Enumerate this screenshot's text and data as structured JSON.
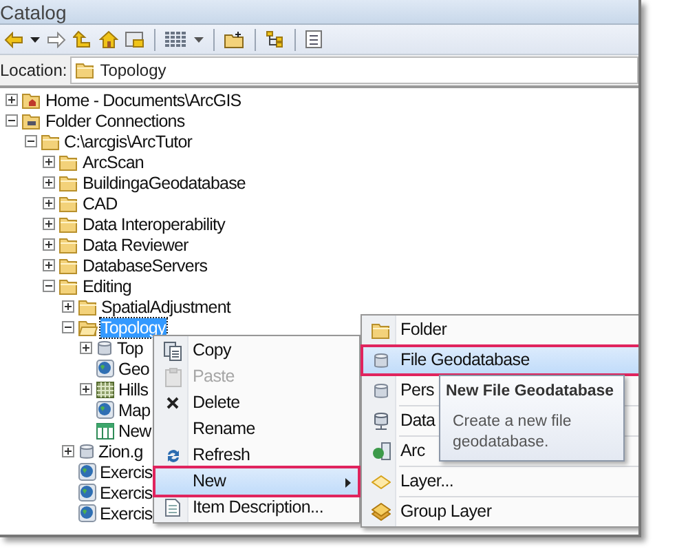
{
  "window": {
    "title": "Catalog"
  },
  "location": {
    "label": "Location:",
    "value": "Topology"
  },
  "tree": [
    {
      "label": "Home - Documents\\ArcGIS",
      "kind": "home",
      "expanded": false,
      "selected": false
    },
    {
      "label": "Folder Connections",
      "kind": "connections",
      "expanded": true,
      "selected": false,
      "children": [
        {
          "label": "C:\\arcgis\\ArcTutor",
          "kind": "folder",
          "expanded": true,
          "selected": false,
          "children": [
            {
              "label": "ArcScan",
              "kind": "folder",
              "expanded": false,
              "selected": false
            },
            {
              "label": "BuildingaGeodatabase",
              "kind": "folder",
              "expanded": false,
              "selected": false
            },
            {
              "label": "CAD",
              "kind": "folder",
              "expanded": false,
              "selected": false
            },
            {
              "label": "Data Interoperability",
              "kind": "folder",
              "expanded": false,
              "selected": false
            },
            {
              "label": "Data Reviewer",
              "kind": "folder",
              "expanded": false,
              "selected": false
            },
            {
              "label": "DatabaseServers",
              "kind": "folder",
              "expanded": false,
              "selected": false
            },
            {
              "label": "Editing",
              "kind": "folder",
              "expanded": true,
              "selected": false,
              "children": [
                {
                  "label": "SpatialAdjustment",
                  "kind": "folder",
                  "expanded": false,
                  "selected": false
                },
                {
                  "label": "Topology",
                  "kind": "openfolder",
                  "expanded": true,
                  "selected": true,
                  "children": [
                    {
                      "label": "Top",
                      "kind": "gdb",
                      "expanded": false,
                      "selected": false
                    },
                    {
                      "label": "Geo",
                      "kind": "globe",
                      "selected": false
                    },
                    {
                      "label": "Hills",
                      "kind": "raster",
                      "expanded": false,
                      "selected": false
                    },
                    {
                      "label": "Map",
                      "kind": "globe",
                      "selected": false
                    },
                    {
                      "label": "New",
                      "kind": "table",
                      "selected": false
                    }
                  ]
                },
                {
                  "label": "Zion.g",
                  "kind": "gdb",
                  "expanded": false,
                  "selected": false
                },
                {
                  "label": "Exercis",
                  "kind": "globe",
                  "selected": false
                },
                {
                  "label": "Exercis",
                  "kind": "globe",
                  "selected": false
                },
                {
                  "label": "Exercis",
                  "kind": "globe",
                  "selected": false
                }
              ]
            }
          ]
        }
      ]
    }
  ],
  "context_menu": {
    "items": [
      {
        "label": "Copy",
        "kind": "copy",
        "disabled": false,
        "selected": false
      },
      {
        "label": "Paste",
        "kind": "paste",
        "disabled": true,
        "selected": false
      },
      {
        "label": "Delete",
        "kind": "delete",
        "disabled": false,
        "selected": false
      },
      {
        "label": "Rename",
        "kind": "plain",
        "disabled": false,
        "selected": false
      },
      {
        "label": "Refresh",
        "kind": "refresh",
        "disabled": false,
        "selected": false
      },
      {
        "label": "New",
        "kind": "submenu",
        "disabled": false,
        "selected": true
      },
      {
        "label": "Item Description...",
        "kind": "description",
        "disabled": false,
        "selected": false
      }
    ]
  },
  "submenu": {
    "items": [
      {
        "label": "Folder",
        "kind": "folder",
        "selected": false
      },
      {
        "label": "File Geodatabase",
        "kind": "gdb",
        "selected": true
      },
      {
        "label": "Pers",
        "kind": "gdb",
        "selected": false
      },
      {
        "label": "Data",
        "kind": "dbconn",
        "selected": false
      },
      {
        "label": "Arc",
        "kind": "arcserver",
        "selected": false
      },
      {
        "label": "Layer...",
        "kind": "layer",
        "selected": false
      },
      {
        "label": "Group Layer",
        "kind": "grouplayer",
        "selected": false
      }
    ]
  },
  "tooltip": {
    "title": "New File Geodatabase",
    "text": "Create a new file geodatabase."
  }
}
